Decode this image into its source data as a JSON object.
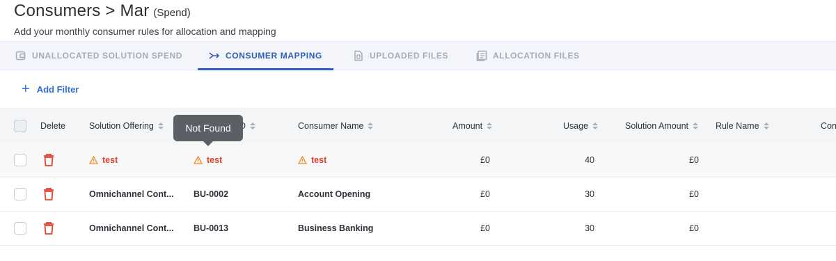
{
  "header": {
    "title": "Consumers > Mar",
    "title_suffix": "(Spend)",
    "subtitle": "Add your monthly consumer rules for allocation and mapping"
  },
  "tabs": [
    {
      "label": "UNALLOCATED SOLUTION SPEND",
      "icon": "wallet-icon",
      "active": false
    },
    {
      "label": "CONSUMER MAPPING",
      "icon": "mapping-arrow-icon",
      "active": true
    },
    {
      "label": "UPLOADED FILES",
      "icon": "file-icon",
      "active": false
    },
    {
      "label": "ALLOCATION FILES",
      "icon": "document-list-icon",
      "active": false
    }
  ],
  "filter": {
    "add_label": "Add Filter"
  },
  "table": {
    "columns": [
      "Delete",
      "Solution Offering",
      "D",
      "Consumer Name",
      "Amount",
      "Usage",
      "Solution Amount",
      "Rule Name",
      "Con"
    ],
    "rows": [
      {
        "solution": "test",
        "id": "test",
        "consumer": "test",
        "amount": "£0",
        "usage": "40",
        "solution_amount": "£0",
        "rule": "",
        "warning": true
      },
      {
        "solution": "Omnichannel Cont...",
        "id": "BU-0002",
        "consumer": "Account Opening",
        "amount": "£0",
        "usage": "30",
        "solution_amount": "£0",
        "rule": "",
        "warning": false
      },
      {
        "solution": "Omnichannel Cont...",
        "id": "BU-0013",
        "consumer": "Business Banking",
        "amount": "£0",
        "usage": "30",
        "solution_amount": "£0",
        "rule": "",
        "warning": false
      }
    ]
  },
  "tooltip": {
    "text": "Not Found"
  },
  "colors": {
    "accent": "#2f5fb8",
    "danger": "#e0412f",
    "warning": "#f08a24"
  }
}
